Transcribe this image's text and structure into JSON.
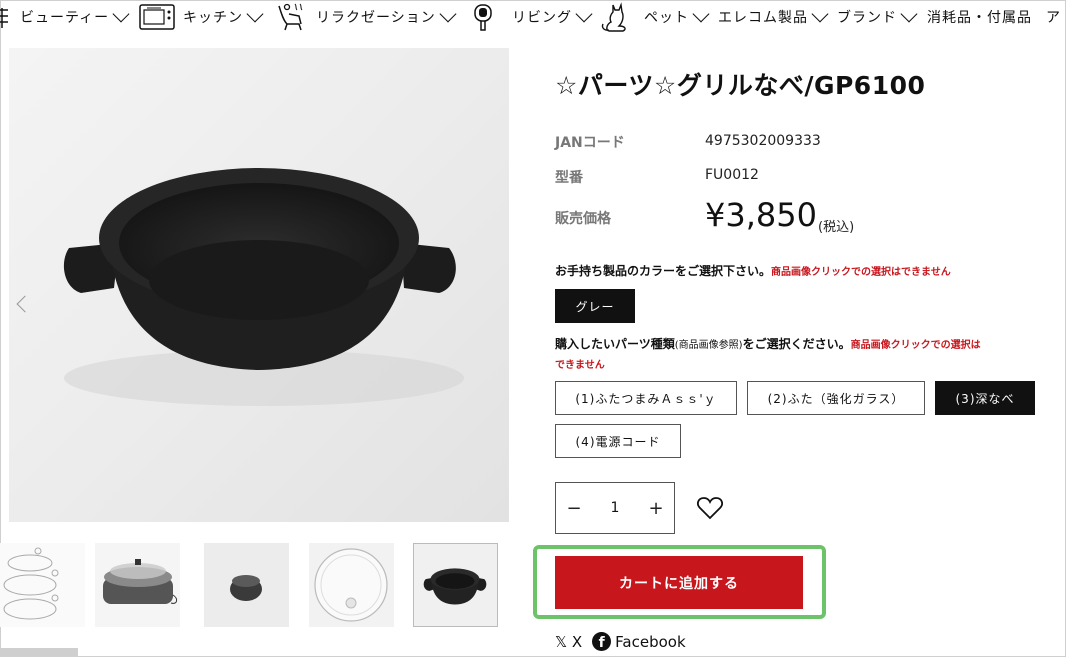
{
  "nav": {
    "items": [
      {
        "label": "ビューティー",
        "icon": "beauty-icon"
      },
      {
        "label": "キッチン",
        "icon": "oven-icon"
      },
      {
        "label": "リラクゼーション",
        "icon": "massage-chair-icon"
      },
      {
        "label": "リビング",
        "icon": "fabric-shaver-icon"
      },
      {
        "label": "ペット",
        "icon": "cat-icon"
      },
      {
        "label": "エレコム製品"
      },
      {
        "label": "ブランド"
      },
      {
        "label": "消耗品・付属品"
      },
      {
        "label": "ア"
      }
    ]
  },
  "product": {
    "title": "☆パーツ☆グリルなべ/GP6100",
    "jan_label": "JANコード",
    "jan_value": "4975302009333",
    "model_label": "型番",
    "model_value": "FU0012",
    "price_label": "販売価格",
    "price": "¥3,850",
    "tax": "(税込)"
  },
  "color_select": {
    "label": "お手持ち製品のカラーをご選択下さい。",
    "warning": "商品画像クリックでの選択はできません",
    "options": [
      {
        "label": "グレー",
        "selected": true
      }
    ]
  },
  "parts_select": {
    "label_main": "購入したいパーツ種類",
    "label_small": "(商品画像参照)",
    "label_end": "をご選択ください。",
    "warning_1": "商品画像クリックでの選択は",
    "warning_2": "できません",
    "options": [
      {
        "label": "(1)ふたつまみＡｓｓ'ｙ",
        "selected": false
      },
      {
        "label": "(2)ふた（強化ガラス）",
        "selected": false
      },
      {
        "label": "(3)深なべ",
        "selected": true
      },
      {
        "label": "(4)電源コード",
        "selected": false
      }
    ]
  },
  "quantity": {
    "minus": "−",
    "value": "1",
    "plus": "+"
  },
  "cart": {
    "label": "カートに追加する"
  },
  "share": {
    "x_label": "X",
    "facebook_label": "Facebook"
  },
  "colors": {
    "accent_red": "#c8161d",
    "highlight_green": "#6dc36a",
    "selected_black": "#111111"
  }
}
